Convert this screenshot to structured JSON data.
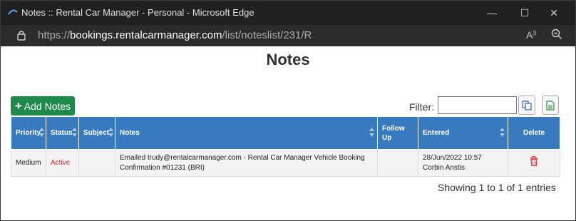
{
  "window": {
    "title": "Notes :: Rental Car Manager - Personal - Microsoft Edge"
  },
  "address": {
    "scheme": "https://",
    "host": "bookings.rentalcarmanager.com",
    "path": "/list/noteslist/231/R"
  },
  "page": {
    "title": "Notes"
  },
  "toolbar": {
    "add_label": "Add Notes",
    "filter_label": "Filter:",
    "filter_value": ""
  },
  "table": {
    "headers": [
      "Priority",
      "Status",
      "Subject",
      "Notes",
      "Follow Up",
      "Entered",
      "Delete"
    ],
    "rows": [
      {
        "priority": "Medium",
        "status": "Active",
        "subject": "",
        "notes": "Emailed trudy@rentalcarmanager.com - Rental Car Manager Vehicle Booking Confirmation #01231 (BRI)",
        "follow_up": "",
        "entered": "28/Jun/2022 10:57 Corbin Anstis"
      }
    ]
  },
  "footer": {
    "info": "Showing 1 to 1 of 1 entries"
  },
  "colors": {
    "header": "#377abd",
    "add_button": "#1e8a4a",
    "status_active": "#d42a2a",
    "delete_icon": "#e03c3c"
  }
}
